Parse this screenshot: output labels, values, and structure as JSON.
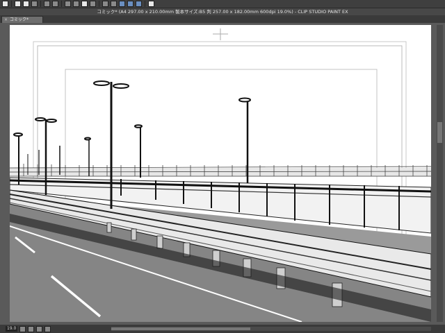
{
  "toolbar": {
    "buttons": [
      "view-icon",
      "new-icon",
      "open-icon",
      "save-icon",
      "undo-icon",
      "redo-icon",
      "select-icon",
      "transform-icon",
      "eraser-icon",
      "cut-icon",
      "fill-icon",
      "ruler-icon",
      "snap-icon",
      "help-icon"
    ]
  },
  "window": {
    "title": "コミック* (A4 297.00 x 210.00mm 製本サイズ:B5 判 257.00 x 182.00mm 600dpi 19.0%) - CLIP STUDIO PAINT EX"
  },
  "tab": {
    "close": "×",
    "label": "コミック*"
  },
  "status": {
    "zoom": "19.0"
  }
}
